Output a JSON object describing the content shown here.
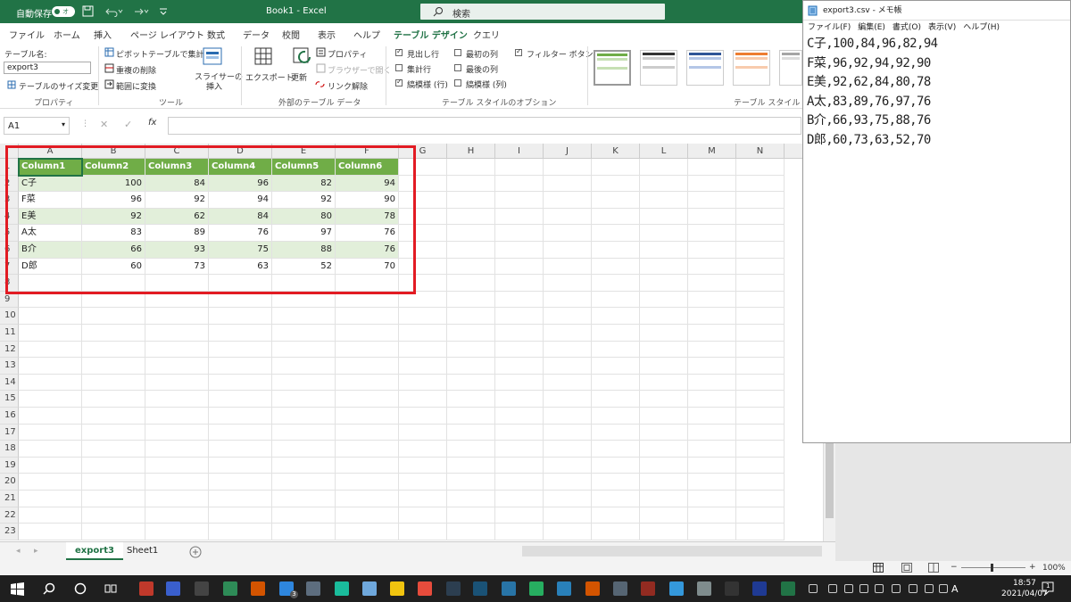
{
  "titlebar": {
    "autosave_label": "自動保存",
    "autosave_state": "オフ",
    "file_title": "Book1  -  Excel",
    "search_placeholder": "検索"
  },
  "tabs": [
    "ファイル",
    "ホーム",
    "挿入",
    "ページ レイアウト",
    "数式",
    "データ",
    "校閲",
    "表示",
    "ヘルプ",
    "テーブル デザイン",
    "クエリ"
  ],
  "active_tab": "テーブル デザイン",
  "ribbon": {
    "table_name_label": "テーブル名:",
    "table_name_value": "export3",
    "resize_table": "テーブルのサイズ変更",
    "group_properties": "プロパティ",
    "pivot_summary": "ピボットテーブルで集計",
    "remove_duplicates": "重複の削除",
    "convert_range": "範囲に変換",
    "slicer_insert_1": "スライサーの",
    "slicer_insert_2": "挿入",
    "group_tools": "ツール",
    "export": "エクスポート",
    "refresh": "更新",
    "properties": "プロパティ",
    "open_browser": "ブラウザーで開く",
    "unlink": "リンク解除",
    "group_external": "外部のテーブル データ",
    "header_row": "見出し行",
    "total_row": "集計行",
    "banded_rows": "縞模様 (行)",
    "first_column": "最初の列",
    "last_column": "最後の列",
    "banded_columns": "縞模様 (列)",
    "filter_button": "フィルター ボタン",
    "group_style_options": "テーブル スタイルのオプション",
    "group_table_styles": "テーブル スタイル"
  },
  "formula_bar": {
    "name_box": "A1",
    "fx": "fx",
    "content": ""
  },
  "grid": {
    "columns": [
      "A",
      "B",
      "C",
      "D",
      "E",
      "F",
      "G",
      "H",
      "I",
      "J",
      "K",
      "L",
      "M",
      "N"
    ],
    "rows": [
      "1",
      "2",
      "3",
      "4",
      "5",
      "6",
      "7",
      "8",
      "9",
      "10",
      "11",
      "12",
      "13",
      "14",
      "15",
      "16",
      "17",
      "18",
      "19",
      "20",
      "21",
      "22",
      "23"
    ],
    "table_headers": [
      "Column1",
      "Column2",
      "Column3",
      "Column4",
      "Column5",
      "Column6"
    ],
    "table_rows": [
      [
        "C子",
        "100",
        "84",
        "96",
        "82",
        "94"
      ],
      [
        "F菜",
        "96",
        "92",
        "94",
        "92",
        "90"
      ],
      [
        "E美",
        "92",
        "62",
        "84",
        "80",
        "78"
      ],
      [
        "A太",
        "83",
        "89",
        "76",
        "97",
        "76"
      ],
      [
        "B介",
        "66",
        "93",
        "75",
        "88",
        "76"
      ],
      [
        "D郎",
        "60",
        "73",
        "63",
        "52",
        "70"
      ]
    ]
  },
  "sheets": [
    "export3",
    "Sheet1"
  ],
  "active_sheet": "export3",
  "status": {
    "zoom": "100%"
  },
  "notepad": {
    "title": "export3.csv - メモ帳",
    "menu": [
      "ファイル(F)",
      "編集(E)",
      "書式(O)",
      "表示(V)",
      "ヘルプ(H)"
    ],
    "lines": [
      "C子,100,84,96,82,94",
      "F菜,96,92,94,92,90",
      "E美,92,62,84,80,78",
      "A太,83,89,76,97,76",
      "B介,66,93,75,88,76",
      "D郎,60,73,63,52,70"
    ]
  },
  "taskbar": {
    "time": "18:57",
    "date": "2021/04/07",
    "ime": "A",
    "notif_count": "1",
    "mail_badge": "3"
  },
  "colors": {
    "excel_green": "#217346",
    "table_header": "#70ad47",
    "band": "#e2efda",
    "highlight_red": "#e21b23"
  }
}
